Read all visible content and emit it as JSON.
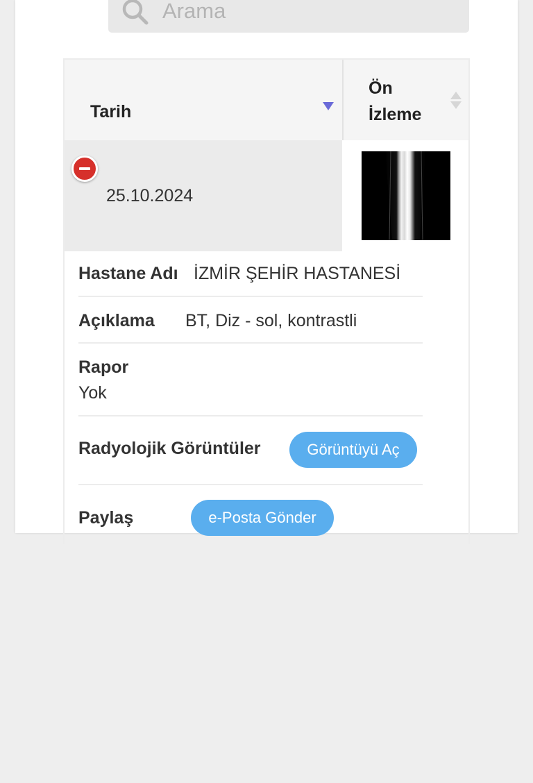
{
  "search": {
    "placeholder": "Arama"
  },
  "table": {
    "columns": [
      "Tarih",
      "Ön İzleme"
    ],
    "rows": [
      {
        "date": "25.10.2024"
      }
    ]
  },
  "details": {
    "hospital_label": "Hastane Adı",
    "hospital_value": "İZMİR ŞEHİR HASTANESİ",
    "description_label": "Açıklama",
    "description_value": "BT, Diz - sol, kontrastli",
    "report_label": "Rapor",
    "report_value": "Yok",
    "images_label": "Radyolojik Görüntüler",
    "open_image_button": "Görüntüyü Aç",
    "share_label": "Paylaş",
    "send_email_button": "e-Posta Gönder"
  },
  "colors": {
    "accent_button": "#5aaeee",
    "collapse_red": "#d6302b",
    "sort_active": "#6a6ad8"
  },
  "icons": [
    "search-icon",
    "sort-desc-icon",
    "sort-both-icon",
    "collapse-row-icon"
  ]
}
